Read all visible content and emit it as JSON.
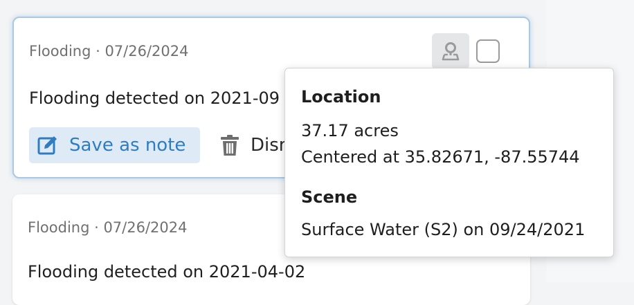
{
  "cards": [
    {
      "meta": "Flooding · 07/26/2024",
      "description": "Flooding detected on 2021-09",
      "save_label": "Save as note",
      "dismiss_label": "Dism"
    },
    {
      "meta": "Flooding · 07/26/2024",
      "description": "Flooding detected on 2021-04-02"
    }
  ],
  "popover": {
    "location_heading": "Location",
    "area": "37.17 acres",
    "center": "Centered at 35.82671, -87.55744",
    "scene_heading": "Scene",
    "scene": "Surface Water (S2) on 09/24/2021"
  },
  "icons": {
    "map_pin": "map-pin-icon",
    "edit": "edit-note-icon",
    "trash": "trash-icon"
  },
  "colors": {
    "accent": "#2f7cc0",
    "accent_bg": "#deebf7",
    "selected_border": "#a9c8e6"
  }
}
